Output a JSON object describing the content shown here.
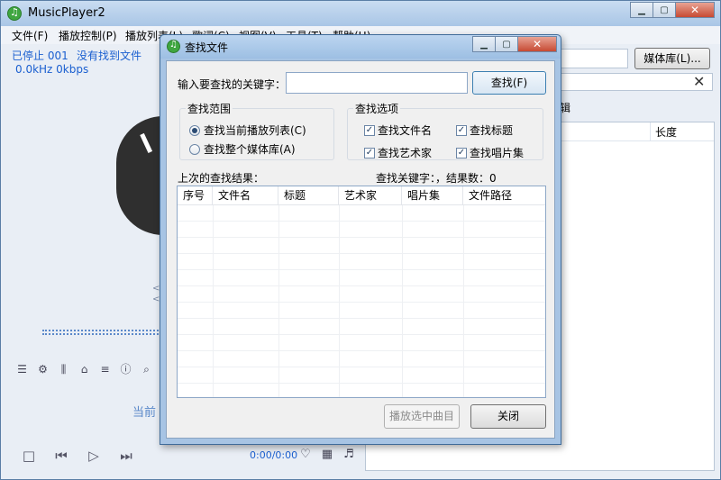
{
  "main_window": {
    "title": "MusicPlayer2",
    "menu": [
      "文件(F)",
      "播放控制(P)",
      "播放列表(L)",
      "歌词(C)",
      "视图(V)",
      "工具(T)",
      "帮助(H)"
    ],
    "status_stopped": "已停止 001",
    "status_nofile": "没有找到文件",
    "status_freq": "0.0kHz 0kbps",
    "current_label": "当前",
    "time_display": "0:00/0:00",
    "media_library_button": "媒体库(L)...",
    "album_header": "辑",
    "length_header": "长度"
  },
  "dialog": {
    "title": "查找文件",
    "keyword_label": "输入要查找的关键字：",
    "keyword_value": "",
    "find_button": "查找(F)",
    "scope": {
      "title": "查找范围",
      "options": [
        {
          "label": "查找当前播放列表(C)",
          "checked": true
        },
        {
          "label": "查找整个媒体库(A)",
          "checked": false
        }
      ]
    },
    "options": {
      "title": "查找选项",
      "items": [
        {
          "label": "查找文件名",
          "checked": true
        },
        {
          "label": "查找标题",
          "checked": true
        },
        {
          "label": "查找艺术家",
          "checked": true
        },
        {
          "label": "查找唱片集",
          "checked": true
        }
      ]
    },
    "last_results_label": "上次的查找结果：",
    "results_summary": "查找关键字：，结果数：0",
    "columns": [
      "序号",
      "文件名",
      "标题",
      "艺术家",
      "唱片集",
      "文件路径"
    ],
    "play_selected_button": "播放选中曲目",
    "close_button": "关闭"
  },
  "icons": {
    "caption": [
      "minimize-icon",
      "maximize-icon",
      "close-icon"
    ],
    "tools": [
      "playlist-icon",
      "gear-icon",
      "equalizer-icon",
      "skin-icon",
      "menu-icon",
      "info-icon",
      "search-icon"
    ],
    "playback": [
      "stop-icon",
      "previous-icon",
      "play-icon",
      "next-icon"
    ],
    "bottom": [
      "favorite-icon",
      "grid-icon",
      "lyrics-icon"
    ]
  }
}
